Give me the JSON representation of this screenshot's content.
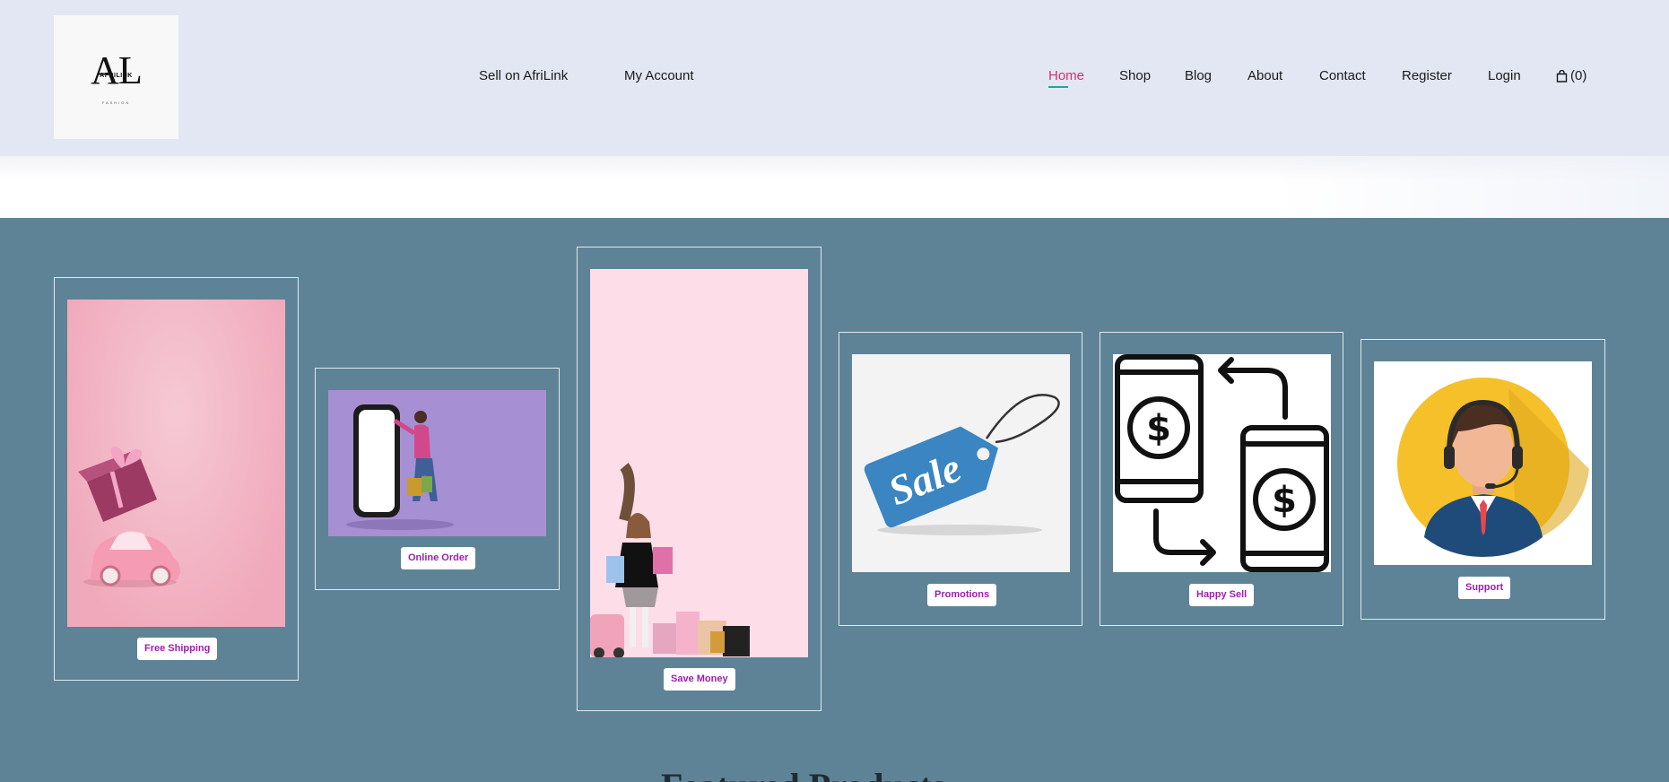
{
  "header": {
    "logo": {
      "mark": "AL",
      "name": "AFRILINK",
      "tagline": "FASHION"
    },
    "secondary_nav": [
      {
        "label": "Sell on AfriLink"
      },
      {
        "label": "My Account"
      }
    ],
    "main_nav": [
      {
        "label": "Home",
        "active": true
      },
      {
        "label": "Shop"
      },
      {
        "label": "Blog"
      },
      {
        "label": "About"
      },
      {
        "label": "Contact"
      },
      {
        "label": "Register"
      },
      {
        "label": "Login"
      }
    ],
    "cart": {
      "icon": "shopping-bag-icon",
      "count_label": "(0)"
    }
  },
  "features": [
    {
      "label": "Free Shipping",
      "image": "pink toy car carrying a gift box on pink background"
    },
    {
      "label": "Online Order",
      "image": "woman with shopping bags touching a giant smartphone on purple background"
    },
    {
      "label": "Save Money",
      "image": "girl holding shopping bags with pink car and bags on pink background"
    },
    {
      "label": "Promotions",
      "image": "blue sale tag"
    },
    {
      "label": "Happy Sell",
      "image": "two phones with dollar symbols and exchange arrows"
    },
    {
      "label": "Support",
      "image": "customer support agent with headset in yellow circle"
    }
  ],
  "sale_tag_text": "Sale",
  "section_heading": "Featured Products",
  "colors": {
    "header_bg": "#e3e7f3",
    "section_bg": "#5f8396",
    "active_nav": "#d0306f",
    "button_text": "#9c1faa"
  }
}
